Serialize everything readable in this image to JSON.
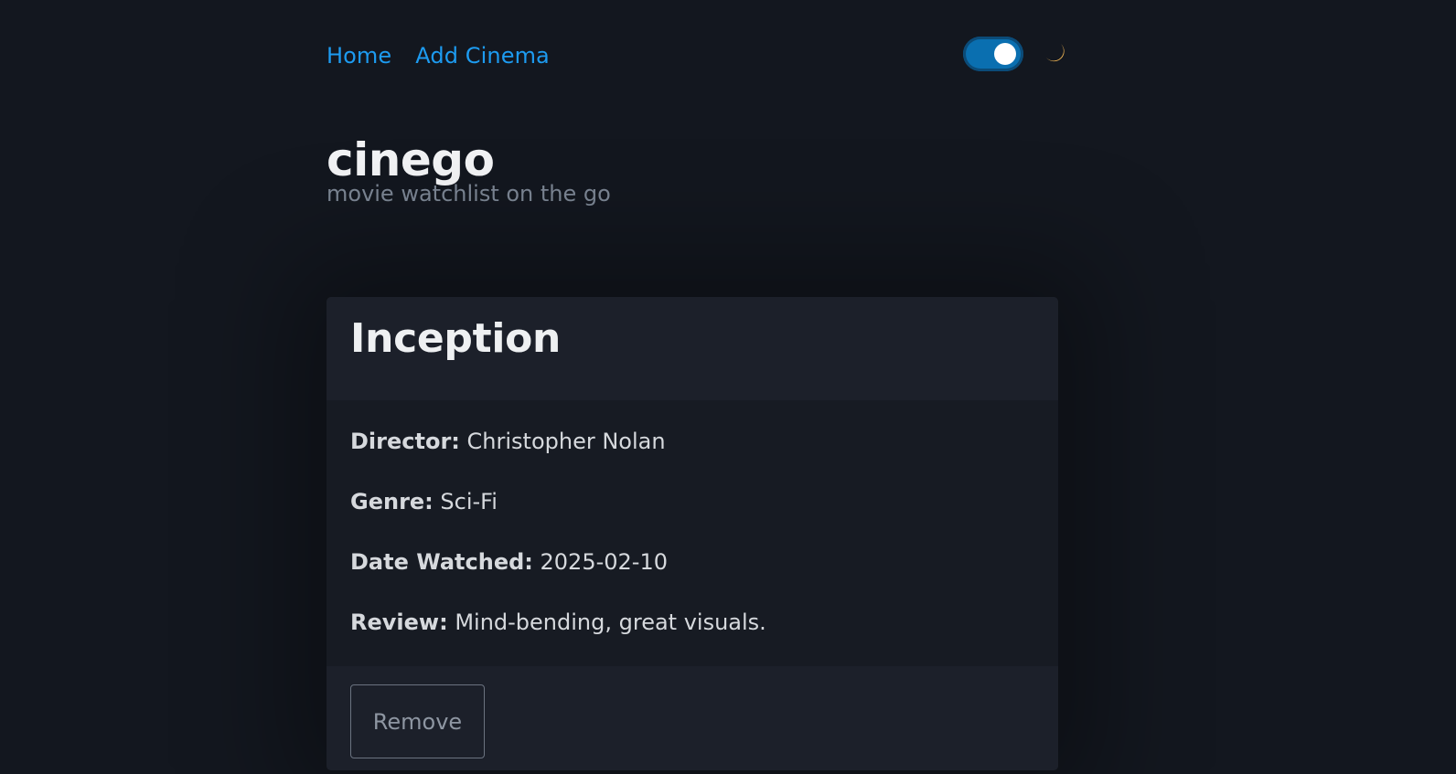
{
  "nav": {
    "links": [
      "Home",
      "Add Cinema"
    ],
    "theme_toggle": {
      "state": "on"
    },
    "theme_icon": "moon-icon"
  },
  "brand": {
    "title": "cinego",
    "subtitle": "movie watchlist on the go"
  },
  "card": {
    "title": "Inception",
    "fields": [
      {
        "label": "Director:",
        "value": "Christopher Nolan"
      },
      {
        "label": "Genre:",
        "value": "Sci-Fi"
      },
      {
        "label": "Date Watched:",
        "value": "2025-02-10"
      },
      {
        "label": "Review:",
        "value": "Mind-bending, great visuals."
      }
    ],
    "remove_label": "Remove"
  },
  "colors": {
    "background": "#13171f",
    "link": "#1d9bf0",
    "toggle_on": "#0a6fb0",
    "moon": "#f5b955"
  }
}
